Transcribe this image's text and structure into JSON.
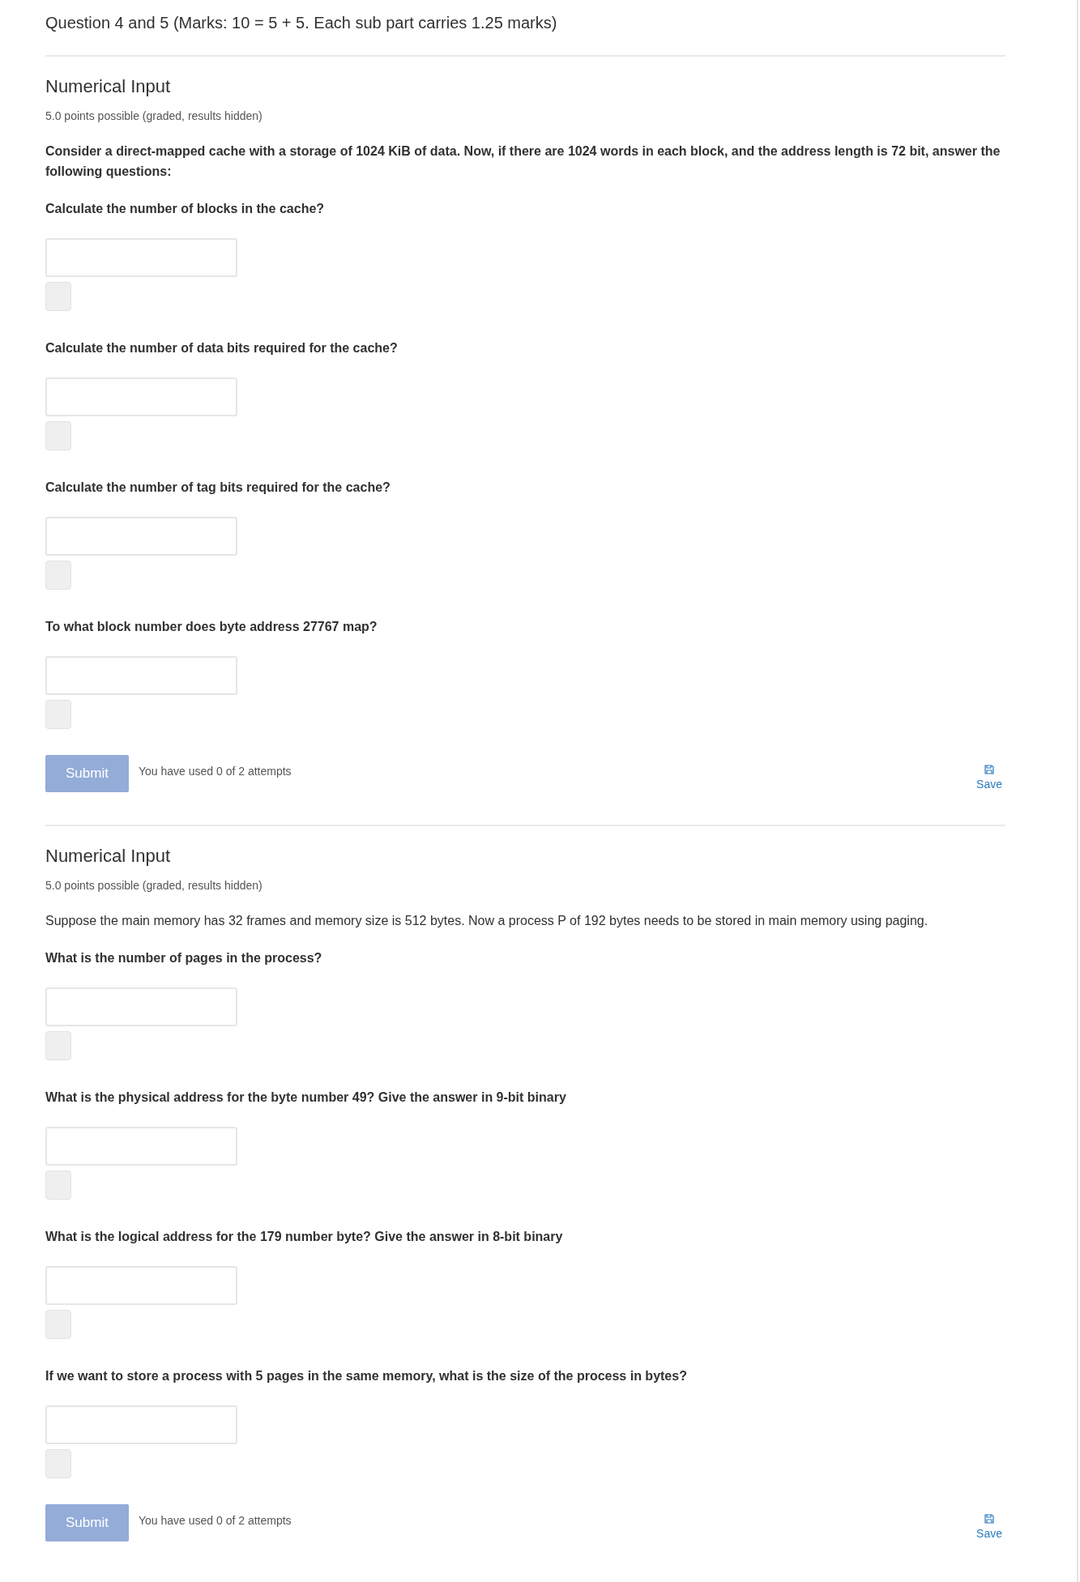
{
  "header": {
    "title": "Question 4 and 5 (Marks: 10 = 5 + 5. Each sub part carries 1.25 marks)"
  },
  "problems": [
    {
      "heading": "Numerical Input",
      "points": "5.0 points possible (graded, results hidden)",
      "prompt": {
        "text": "Consider a direct-mapped cache with a storage of 1024 KiB of data. Now, if there are 1024 words in each block, and the address length is 72 bit, answer the following questions:",
        "bold": true
      },
      "questions": [
        {
          "text": "Calculate the number of blocks in the cache?"
        },
        {
          "text": "Calculate the number of data bits required for the cache?"
        },
        {
          "text": "Calculate the number of tag bits required for the cache?"
        },
        {
          "text": "To what block number does byte address 27767 map?"
        }
      ],
      "submit": {
        "label": "Submit",
        "disabled": true
      },
      "attempts": "You have used 0 of 2 attempts",
      "save": {
        "label": "Save"
      }
    },
    {
      "heading": "Numerical Input",
      "points": "5.0 points possible (graded, results hidden)",
      "prompt": {
        "text": "Suppose the main memory has 32 frames and memory size is 512 bytes. Now a process P of 192 bytes needs to be stored in main memory using paging.",
        "bold": false
      },
      "questions": [
        {
          "text": "What is the number of pages in the process?"
        },
        {
          "text": "What is the physical address for the byte number 49? Give the answer in 9-bit binary"
        },
        {
          "text": "What is the logical address for the 179 number byte? Give the answer in 8-bit binary"
        },
        {
          "text": "If we want to store a process with 5 pages in the same memory, what is the size of the process in bytes?"
        }
      ],
      "submit": {
        "label": "Submit",
        "disabled": true
      },
      "attempts": "You have used 0 of 2 attempts",
      "save": {
        "label": "Save"
      }
    }
  ]
}
